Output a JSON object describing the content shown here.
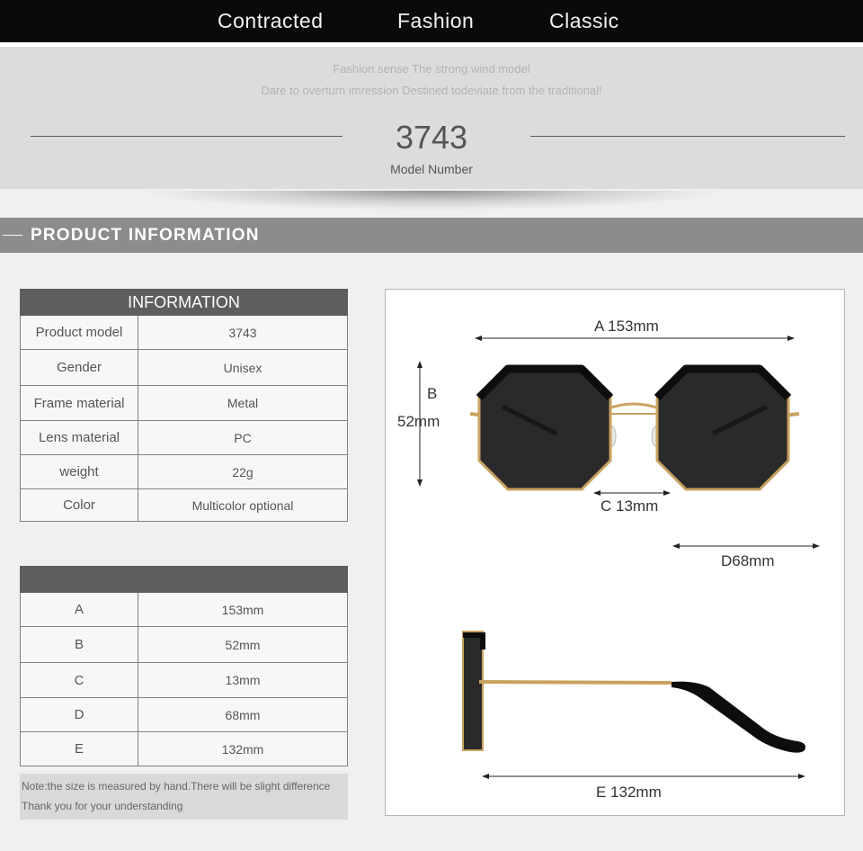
{
  "header": {
    "words": [
      "Contracted",
      "Fashion",
      "Classic"
    ]
  },
  "hero": {
    "tagline_1": "Fashion sense The strong wind model",
    "tagline_2": "Dare to overturn imression Destined todeviate from the traditional!",
    "model_number": "3743",
    "model_label": "Model Number"
  },
  "section": {
    "title": "PRODUCT INFORMATION"
  },
  "info_table": {
    "header": "INFORMATION",
    "rows": [
      {
        "label": "Product model",
        "value": "3743"
      },
      {
        "label": "Gender",
        "value": "Unisex"
      },
      {
        "label": "Frame material",
        "value": "Metal"
      },
      {
        "label": "Lens material",
        "value": "PC"
      },
      {
        "label": "weight",
        "value": "22g"
      },
      {
        "label": "Color",
        "value": "Multicolor optional"
      }
    ]
  },
  "size_table": {
    "header": "",
    "rows": [
      {
        "label": "A",
        "value": "153mm"
      },
      {
        "label": "B",
        "value": "52mm"
      },
      {
        "label": "C",
        "value": "13mm"
      },
      {
        "label": "D",
        "value": "68mm"
      },
      {
        "label": "E",
        "value": "132mm"
      }
    ]
  },
  "note": {
    "line_1": "Note:the size is measured by hand.There will be slight difference",
    "line_2": "Thank you for your understanding"
  },
  "diagram": {
    "a_label": "A 153mm",
    "b_letter": "B",
    "b_value": "52mm",
    "c_label": "C 13mm",
    "d_label": "D68mm",
    "e_label": "E 132mm"
  },
  "colors": {
    "frame_gold": "#c9a261",
    "lens": "#2a2a2a",
    "rim": "#0d0d0d"
  }
}
